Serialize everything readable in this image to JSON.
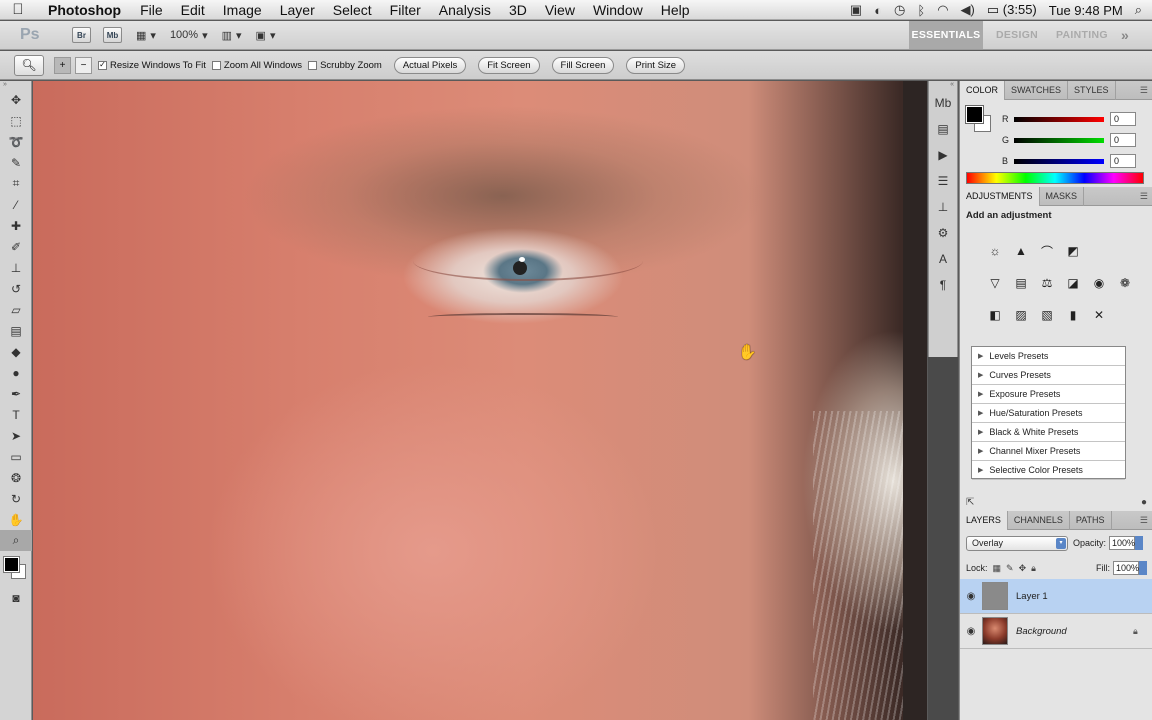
{
  "menubar": {
    "app_name": "Photoshop",
    "menus": [
      "File",
      "Edit",
      "Image",
      "Layer",
      "Select",
      "Filter",
      "Analysis",
      "3D",
      "View",
      "Window",
      "Help"
    ],
    "battery": "(3:55)",
    "clock": "Tue 9:48 PM"
  },
  "appbar": {
    "logo": "Ps",
    "bridge_label": "Br",
    "minibridge_label": "Mb",
    "zoom_level": "100%",
    "workspaces": {
      "essentials": "ESSENTIALS",
      "design": "DESIGN",
      "painting": "PAINTING",
      "more": "»"
    }
  },
  "options": {
    "resize_windows": "Resize Windows To Fit",
    "zoom_all": "Zoom All Windows",
    "scrubby": "Scrubby Zoom",
    "actual_pixels": "Actual Pixels",
    "fit_screen": "Fit Screen",
    "fill_screen": "Fill Screen",
    "print_size": "Print Size",
    "resize_checked": "✓"
  },
  "color_panel": {
    "tabs": [
      "COLOR",
      "SWATCHES",
      "STYLES"
    ],
    "r_label": "R",
    "g_label": "G",
    "b_label": "B",
    "r": "0",
    "g": "0",
    "b": "0"
  },
  "adjustments": {
    "tabs": [
      "ADJUSTMENTS",
      "MASKS"
    ],
    "title": "Add an adjustment",
    "presets": [
      "Levels Presets",
      "Curves Presets",
      "Exposure Presets",
      "Hue/Saturation Presets",
      "Black & White Presets",
      "Channel Mixer Presets",
      "Selective Color Presets"
    ]
  },
  "layers_panel": {
    "tabs": [
      "LAYERS",
      "CHANNELS",
      "PATHS"
    ],
    "blend_mode": "Overlay",
    "opacity_label": "Opacity:",
    "opacity": "100%",
    "lock_label": "Lock:",
    "fill_label": "Fill:",
    "fill": "100%",
    "layers": [
      {
        "name": "Layer 1"
      },
      {
        "name": "Background"
      }
    ]
  },
  "colors": {
    "selection_blue": "#b8d2f2",
    "panel_bg": "#e4e4e4"
  }
}
